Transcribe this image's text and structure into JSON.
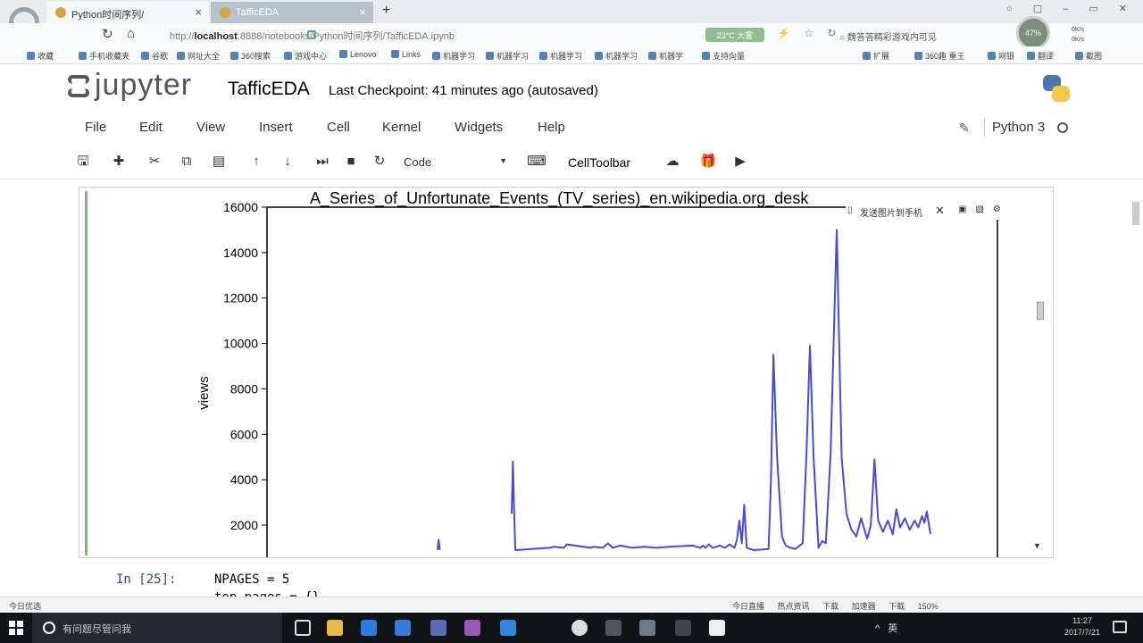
{
  "browser": {
    "tabs": [
      {
        "label": "Python时间序列/",
        "active": false
      },
      {
        "label": "TafficEDA",
        "active": true
      }
    ],
    "new_tab": "+",
    "url_prefix": "http://",
    "url_host": "localhost",
    "url_path": ":8888/notebooks/Python时间序列/TafficEDA.ipynb",
    "pill": "23°C 大雾",
    "news": "○ 魏答答精彩游戏内可见",
    "badge": "47%",
    "speed": [
      "0K/s",
      "0K/s"
    ],
    "bookmarks": [
      "收藏",
      "手机收藏夹",
      "谷歌",
      "网址大全",
      "360搜索",
      "游戏中心",
      "Lenovo",
      "Links",
      "机器学习",
      "机器学习",
      "机器学习",
      "机器学习",
      "机器学",
      "支持向量"
    ],
    "bookmarks_right": [
      "扩展",
      "360趣 重王",
      "网银",
      "翻译",
      "截图"
    ]
  },
  "jupyter": {
    "wordmark": "jupyter",
    "notebook_name": "TafficEDA",
    "checkpoint": "Last Checkpoint: 41 minutes ago (autosaved)",
    "menu": [
      "File",
      "Edit",
      "View",
      "Insert",
      "Cell",
      "Kernel",
      "Widgets",
      "Help"
    ],
    "kernel": "Python 3",
    "cell_type": "Code",
    "celltoolbar": "CellToolbar"
  },
  "plot_widget": {
    "send_to_phone": "发送图片到手机"
  },
  "chart_data": {
    "type": "line",
    "title": "A_Series_of_Unfortunate_Events_(TV_series)_en.wikipedia.org_desk",
    "xlabel": "",
    "ylabel": "views",
    "ylim_visible": [
      1000,
      16000
    ],
    "yticks": [
      2000,
      4000,
      6000,
      8000,
      10000,
      12000,
      14000,
      16000
    ],
    "grid": false,
    "color": "#4a4ad6",
    "series": [
      {
        "x": [
          0,
          140,
          141,
          142,
          200,
          201,
          202,
          203,
          204,
          232,
          236,
          244,
          246,
          266,
          268,
          276,
          280,
          284,
          290,
          300,
          310,
          320,
          330,
          350,
          356,
          358,
          360,
          363,
          366,
          372,
          376,
          380,
          384,
          386,
          388,
          390,
          392,
          394,
          400,
          412,
          414,
          416,
          419,
          423,
          426,
          430,
          434,
          440,
          443,
          446,
          449,
          453,
          456,
          459,
          463,
          468,
          472,
          476,
          480,
          484,
          488,
          493,
          496,
          499,
          502,
          506,
          510,
          514,
          517,
          520,
          524,
          528,
          532,
          535,
          538,
          540,
          542,
          545,
          548,
          552,
          556,
          560
        ],
        "y": [
          null,
          900,
          1350,
          900,
          null,
          2500,
          4800,
          2500,
          900,
          1000,
          1050,
          1000,
          1150,
          1000,
          1050,
          1000,
          1200,
          1000,
          1100,
          1000,
          1050,
          1000,
          1050,
          1100,
          1000,
          1100,
          1000,
          1150,
          1000,
          1100,
          1000,
          1150,
          1000,
          1350,
          2200,
          1200,
          2900,
          1000,
          900,
          950,
          4000,
          9500,
          5000,
          1500,
          1100,
          1000,
          950,
          1200,
          5000,
          9900,
          5000,
          1000,
          1300,
          1200,
          5200,
          15000,
          5000,
          2500,
          1800,
          1500,
          2300,
          1400,
          2000,
          4900,
          2200,
          1700,
          2200,
          1600,
          2700,
          1900,
          2300,
          1800,
          2200,
          1900,
          2400,
          2100,
          2600,
          1600,
          null,
          null,
          null,
          null
        ]
      }
    ]
  },
  "next_cell": {
    "prompt": "In [25]:",
    "line1": "NPAGES = 5",
    "line2": "top_pages = {}"
  },
  "status_strip": {
    "left": "今日优选",
    "right": [
      "今日直播",
      "热点资讯",
      "下载",
      "加速器",
      "下载",
      "150%"
    ]
  },
  "taskbar": {
    "search_placeholder": "有问题尽管问我",
    "tray": "^ 英",
    "time": "11:27",
    "date": "2017/7/21"
  }
}
